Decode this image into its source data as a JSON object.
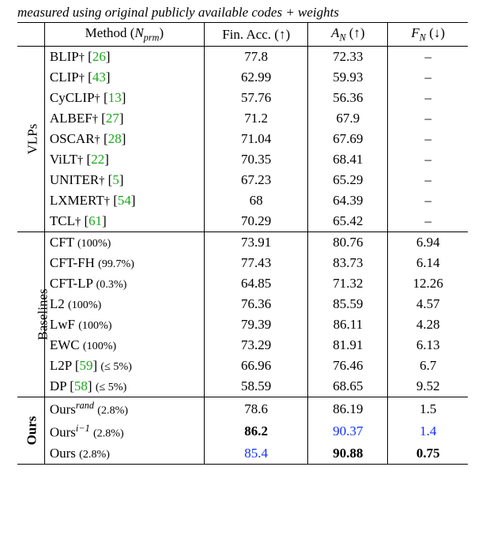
{
  "caption": "measured using original publicly available codes + weights",
  "header": {
    "method": "Method (",
    "method_sub": "N",
    "method_subsub": "prm",
    "method_after": ")",
    "fin": "Fin. Acc. (↑)",
    "an_pre": "A",
    "an_sub": "N",
    "an_post": " (↑)",
    "fn_pre": "F",
    "fn_sub": "N",
    "fn_post": " (↓)"
  },
  "groups": {
    "vlps": "VLPs",
    "baselines": "Baselines",
    "ours": "Ours"
  },
  "vlps": [
    {
      "method": "BLIP",
      "dag": true,
      "ref": "26",
      "fin": "77.8",
      "an": "72.33",
      "fn": "–"
    },
    {
      "method": "CLIP",
      "dag": true,
      "ref": "43",
      "fin": "62.99",
      "an": "59.93",
      "fn": "–"
    },
    {
      "method": "CyCLIP",
      "dag": true,
      "ref": "13",
      "fin": "57.76",
      "an": "56.36",
      "fn": "–"
    },
    {
      "method": "ALBEF",
      "dag": true,
      "ref": "27",
      "fin": "71.2",
      "an": "67.9",
      "fn": "–"
    },
    {
      "method": "OSCAR",
      "dag": true,
      "ref": "28",
      "fin": "71.04",
      "an": "67.69",
      "fn": "–"
    },
    {
      "method": "ViLT",
      "dag": true,
      "ref": "22",
      "fin": "70.35",
      "an": "68.41",
      "fn": "–"
    },
    {
      "method": "UNITER",
      "dag": true,
      "ref": "5",
      "fin": "67.23",
      "an": "65.29",
      "fn": "–"
    },
    {
      "method": "LXMERT",
      "dag": true,
      "ref": "54",
      "fin": "68",
      "an": "64.39",
      "fn": "–"
    },
    {
      "method": "TCL",
      "dag": true,
      "ref": "61",
      "fin": "70.29",
      "an": "65.42",
      "fn": "–"
    }
  ],
  "baselines": [
    {
      "method": "CFT",
      "pct": "(100%)",
      "fin": "73.91",
      "an": "80.76",
      "fn": "6.94"
    },
    {
      "method": "CFT-FH",
      "pct": "(99.7%)",
      "fin": "77.43",
      "an": "83.73",
      "fn": "6.14"
    },
    {
      "method": "CFT-LP",
      "pct": "(0.3%)",
      "fin": "64.85",
      "an": "71.32",
      "fn": "12.26"
    },
    {
      "method": "L2",
      "pct": "(100%)",
      "fin": "76.36",
      "an": "85.59",
      "fn": "4.57"
    },
    {
      "method": "LwF",
      "pct": "(100%)",
      "fin": "79.39",
      "an": "86.11",
      "fn": "4.28"
    },
    {
      "method": "EWC",
      "pct": "(100%)",
      "fin": "73.29",
      "an": "81.91",
      "fn": "6.13"
    },
    {
      "method": "L2P",
      "ref": "59",
      "pct": "(≤ 5%)",
      "fin": "66.96",
      "an": "76.46",
      "fn": "6.7"
    },
    {
      "method": "DP",
      "ref": "58",
      "pct": "(≤ 5%)",
      "fin": "58.59",
      "an": "68.65",
      "fn": "9.52"
    }
  ],
  "ours": [
    {
      "method": "Ours",
      "sup": "rand",
      "pct": "(2.8%)",
      "fin": "78.6",
      "an": "86.19",
      "fn": "1.5"
    },
    {
      "method": "Ours",
      "sup": "i−1",
      "pct": "(2.8%)",
      "fin": "86.2",
      "fin_b": true,
      "an": "90.37",
      "an_blue": true,
      "fn": "1.4",
      "fn_blue": true
    },
    {
      "method": "Ours",
      "pct": "(2.8%)",
      "fin": "85.4",
      "fin_blue": true,
      "an": "90.88",
      "an_b": true,
      "fn": "0.75",
      "fn_b": true
    }
  ],
  "chart_data": {
    "type": "table",
    "columns": [
      "Method (N_prm)",
      "Fin. Acc. (↑)",
      "A_N (↑)",
      "F_N (↓)"
    ],
    "sections": [
      {
        "group": "VLPs",
        "rows": [
          [
            "BLIP† [26]",
            77.8,
            72.33,
            null
          ],
          [
            "CLIP† [43]",
            62.99,
            59.93,
            null
          ],
          [
            "CyCLIP† [13]",
            57.76,
            56.36,
            null
          ],
          [
            "ALBEF† [27]",
            71.2,
            67.9,
            null
          ],
          [
            "OSCAR† [28]",
            71.04,
            67.69,
            null
          ],
          [
            "ViLT† [22]",
            70.35,
            68.41,
            null
          ],
          [
            "UNITER† [5]",
            67.23,
            65.29,
            null
          ],
          [
            "LXMERT† [54]",
            68,
            64.39,
            null
          ],
          [
            "TCL† [61]",
            70.29,
            65.42,
            null
          ]
        ]
      },
      {
        "group": "Baselines",
        "rows": [
          [
            "CFT (100%)",
            73.91,
            80.76,
            6.94
          ],
          [
            "CFT-FH (99.7%)",
            77.43,
            83.73,
            6.14
          ],
          [
            "CFT-LP (0.3%)",
            64.85,
            71.32,
            12.26
          ],
          [
            "L2 (100%)",
            76.36,
            85.59,
            4.57
          ],
          [
            "LwF (100%)",
            79.39,
            86.11,
            4.28
          ],
          [
            "EWC (100%)",
            73.29,
            81.91,
            6.13
          ],
          [
            "L2P [59] (≤ 5%)",
            66.96,
            76.46,
            6.7
          ],
          [
            "DP [58] (≤ 5%)",
            58.59,
            68.65,
            9.52
          ]
        ]
      },
      {
        "group": "Ours",
        "rows": [
          [
            "Ours^rand (2.8%)",
            78.6,
            86.19,
            1.5
          ],
          [
            "Ours^{i-1} (2.8%)",
            86.2,
            90.37,
            1.4
          ],
          [
            "Ours (2.8%)",
            85.4,
            90.88,
            0.75
          ]
        ]
      }
    ]
  }
}
